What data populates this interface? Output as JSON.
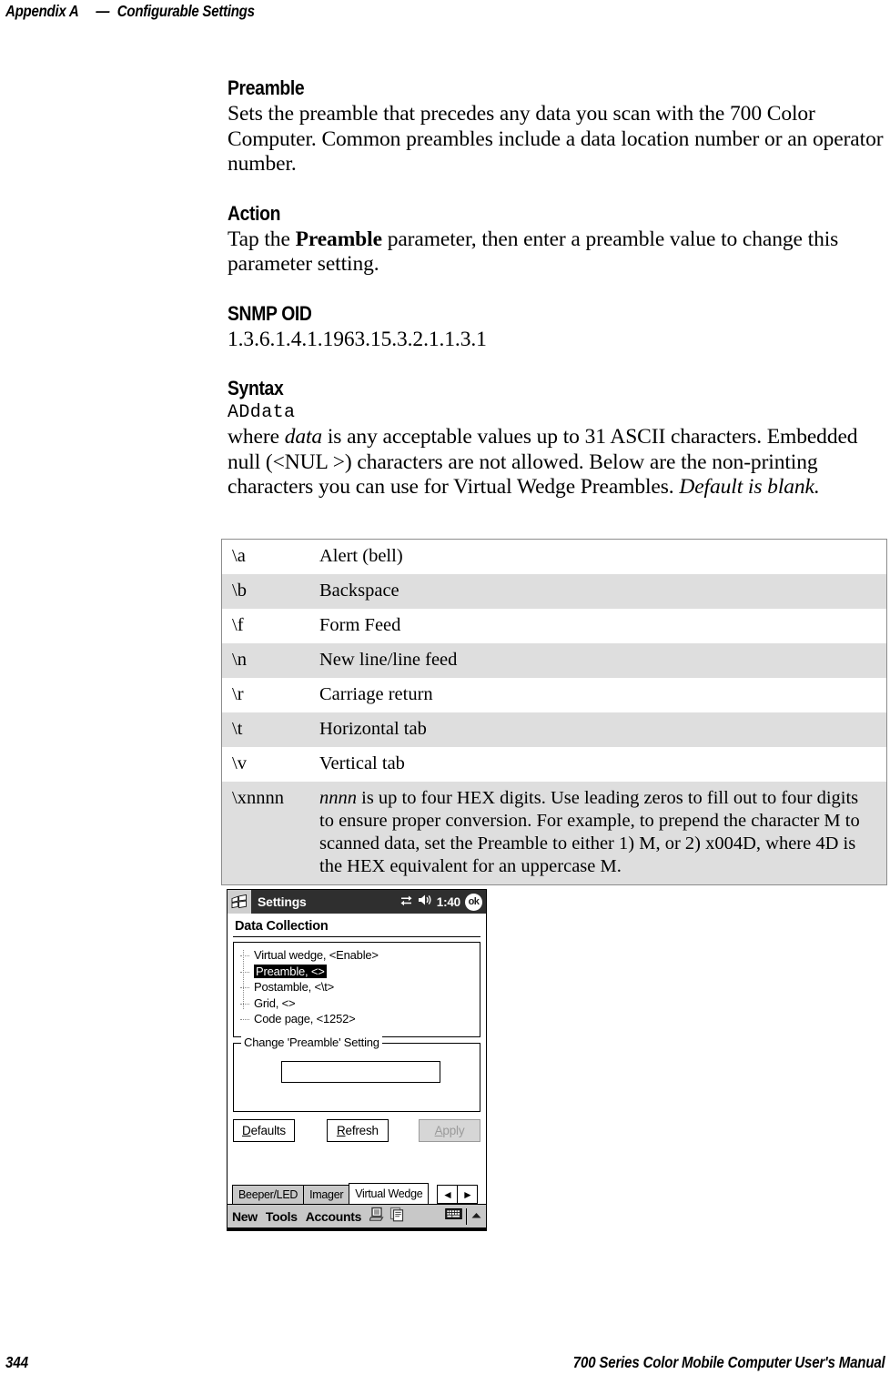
{
  "header": {
    "appendix": "Appendix A",
    "dash": "—",
    "section": "Configurable Settings"
  },
  "sections": {
    "preamble": {
      "heading": "Preamble",
      "body": "Sets the preamble that precedes any data you scan with the 700 Color Computer. Common preambles include a data location number or an operator number."
    },
    "action": {
      "heading": "Action",
      "body_pre": "Tap the ",
      "body_bold": "Preamble",
      "body_post": " parameter, then enter a preamble value to change this parameter setting."
    },
    "snmp": {
      "heading": "SNMP OID",
      "oid": "1.3.6.1.4.1.1963.15.3.2.1.1.3.1"
    },
    "syntax": {
      "heading": "Syntax",
      "code": "ADdata",
      "desc_1": "where ",
      "desc_italic_1": "data",
      "desc_2": " is any acceptable values up to 31 ASCII characters. Embedded null (<NUL >) characters are not allowed. Below are the non-printing characters you can use for Virtual Wedge Preambles. ",
      "desc_italic_2": "Default is blank."
    }
  },
  "escape_table": {
    "rows": [
      {
        "code": "\\a",
        "desc": "Alert (bell)"
      },
      {
        "code": "\\b",
        "desc": "Backspace"
      },
      {
        "code": "\\f",
        "desc": "Form Feed"
      },
      {
        "code": "\\n",
        "desc": "New line/line feed"
      },
      {
        "code": "\\r",
        "desc": "Carriage return"
      },
      {
        "code": "\\t",
        "desc": "Horizontal tab"
      },
      {
        "code": "\\v",
        "desc": "Vertical tab"
      }
    ],
    "last_row": {
      "code": "\\xnnnn",
      "desc_italic": "nnnn",
      "desc": " is up to four HEX digits. Use leading zeros to fill out to four digits to ensure proper conversion. For example, to prepend the character M to scanned data, set the Preamble to either 1) M, or 2) x004D, where 4D is the HEX equivalent for an uppercase M."
    }
  },
  "pda": {
    "titlebar": {
      "logo_icon": "windows-logo-icon",
      "title": "Settings",
      "connectivity_icon": "connectivity-icon",
      "volume_icon": "speaker-icon",
      "time": "1:40",
      "ok_label": "ok"
    },
    "page_heading": "Data Collection",
    "tree": {
      "items": [
        {
          "label": "Virtual wedge, <Enable>",
          "selected": false
        },
        {
          "label": "Preamble, <>",
          "selected": true
        },
        {
          "label": "Postamble, <\\t>",
          "selected": false
        },
        {
          "label": "Grid, <>",
          "selected": false
        },
        {
          "label": "Code page, <1252>",
          "selected": false
        }
      ]
    },
    "groupbox": {
      "legend": "Change 'Preamble' Setting",
      "input_value": "",
      "input_placeholder": ""
    },
    "buttons": {
      "defaults": {
        "accel": "D",
        "rest": "efaults",
        "enabled": true
      },
      "refresh": {
        "accel": "R",
        "rest": "efresh",
        "enabled": true
      },
      "apply": {
        "accel": "A",
        "rest": "pply",
        "enabled": false
      }
    },
    "tabs": [
      {
        "label": "Beeper/LED",
        "active": false
      },
      {
        "label": "Imager",
        "active": false
      },
      {
        "label": "Virtual Wedge",
        "active": true
      }
    ],
    "tab_scroll": {
      "left": "◄",
      "right": "►"
    },
    "taskbar": {
      "menus": [
        "New",
        "Tools",
        "Accounts"
      ],
      "icons": [
        "desktop-icon",
        "notes-icon"
      ],
      "keyboard_icon": "keyboard-icon",
      "arrow_icon": "up-arrow-icon"
    }
  },
  "footer": {
    "page_number": "344",
    "manual_title": "700 Series Color Mobile Computer User's Manual"
  }
}
